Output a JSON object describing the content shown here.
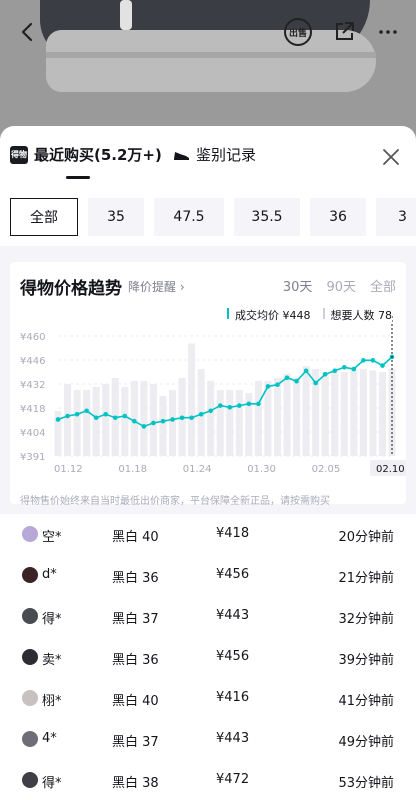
{
  "hero": {
    "sell_label": "出售"
  },
  "tabs": [
    {
      "label": "最近购买(5.2万+)",
      "icon": "dewu-logo-icon",
      "icon_text": "得物"
    },
    {
      "label": "鉴别记录",
      "icon": "shoe-icon"
    }
  ],
  "sizes": [
    "全部",
    "35",
    "47.5",
    "35.5",
    "36",
    "3"
  ],
  "chart": {
    "title": "得物价格趋势",
    "alert_label": "降价提醒 ›",
    "ranges": [
      "30天",
      "90天",
      "全部"
    ],
    "legend_avg": "成交均价 ¥448",
    "legend_want": "想要人数 78",
    "note": "得物售价始终来自当时最低出价商家，平台保障全新正品，请按需购买"
  },
  "chart_data": {
    "type": "line",
    "x_tick_labels": [
      "01.12",
      "01.18",
      "01.24",
      "01.30",
      "02.05",
      "02.10"
    ],
    "y_tick_labels": [
      "¥460",
      "¥446",
      "¥432",
      "¥418",
      "¥404",
      "¥391"
    ],
    "ylim": [
      391,
      460
    ],
    "series": [
      {
        "name": "成交均价",
        "values": [
          412,
          414,
          415,
          417,
          413,
          415,
          413,
          414,
          411,
          408,
          410,
          411,
          412,
          413,
          413,
          415,
          417,
          420,
          419,
          420,
          421,
          421,
          431,
          432,
          436,
          434,
          440,
          433,
          438,
          440,
          442,
          441,
          446,
          446,
          443,
          448
        ]
      },
      {
        "name": "想要人数",
        "values": [
          30,
          48,
          44,
          44,
          46,
          48,
          52,
          46,
          50,
          50,
          48,
          40,
          44,
          52,
          75,
          58,
          50,
          44,
          44,
          44,
          42,
          50,
          50,
          52,
          55,
          52,
          60,
          58,
          56,
          56,
          56,
          58,
          58,
          57,
          56,
          58
        ]
      }
    ]
  },
  "records": [
    {
      "name": "空*",
      "size": "黑白 40",
      "price": "¥418",
      "time": "20分钟前",
      "avatar": "#b7a8d8"
    },
    {
      "name": "d*",
      "size": "黑白 36",
      "price": "¥456",
      "time": "21分钟前",
      "avatar": "#3b2326"
    },
    {
      "name": "得*",
      "size": "黑白 37",
      "price": "¥443",
      "time": "32分钟前",
      "avatar": "#4a4a52"
    },
    {
      "name": "卖*",
      "size": "黑白 36",
      "price": "¥456",
      "time": "39分钟前",
      "avatar": "#2c2c33"
    },
    {
      "name": "栩*",
      "size": "黑白 40",
      "price": "¥416",
      "time": "41分钟前",
      "avatar": "#c9c0c0"
    },
    {
      "name": "4*",
      "size": "黑白 37",
      "price": "¥443",
      "time": "49分钟前",
      "avatar": "#6e6e78"
    },
    {
      "name": "得*",
      "size": "黑白 38",
      "price": "¥472",
      "time": "53分钟前",
      "avatar": "#3f3f47"
    }
  ]
}
